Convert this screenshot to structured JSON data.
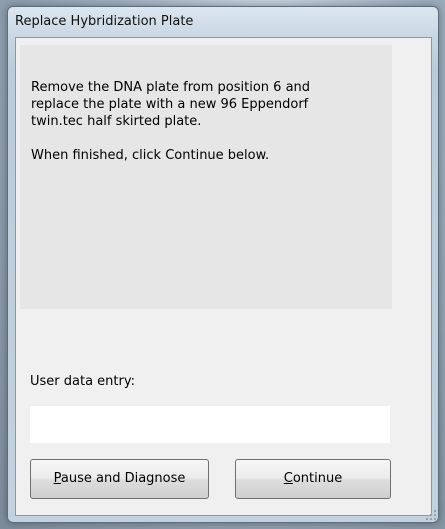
{
  "window": {
    "title": "Replace Hybridization Plate"
  },
  "message": {
    "lines": [
      "Remove the DNA plate from position 6 and",
      "replace the plate with a new 96 Eppendorf",
      "twin.tec half skirted plate."
    ],
    "instruction": "When finished, click Continue below."
  },
  "entry": {
    "label": "User data entry:",
    "value": ""
  },
  "buttons": {
    "pause": {
      "mnemonic": "P",
      "rest": "ause and Diagnose"
    },
    "continue": {
      "mnemonic": "C",
      "rest": "ontinue"
    }
  }
}
